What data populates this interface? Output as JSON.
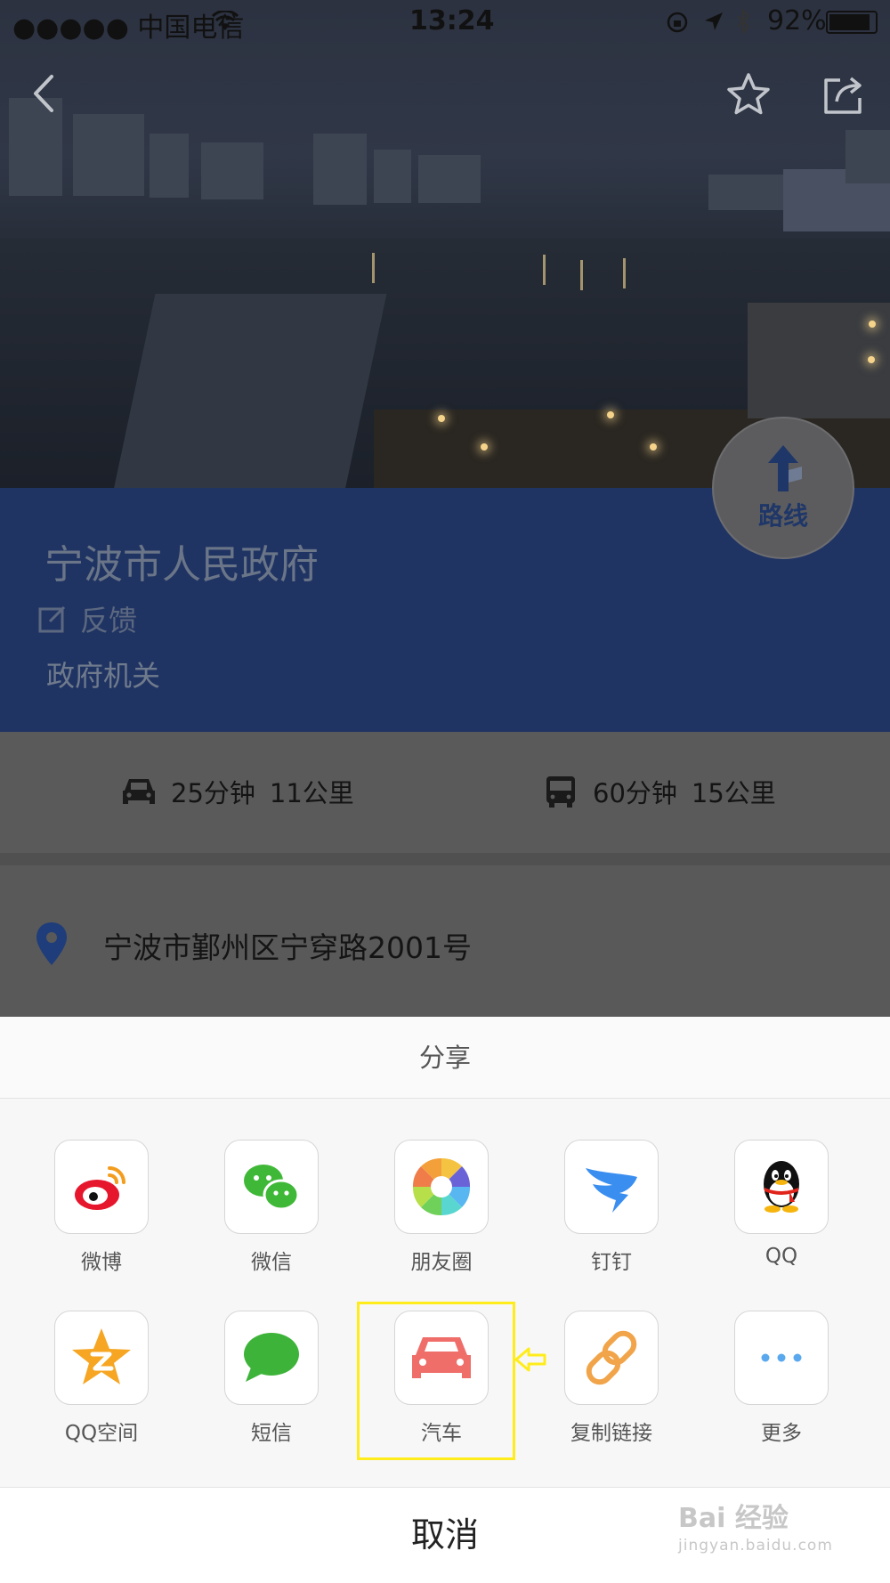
{
  "status_bar": {
    "carrier": "●●●●● 中国电信",
    "time": "13:24",
    "battery": "92%"
  },
  "header": {
    "back_icon": "chevron-left-icon",
    "favorite_icon": "star-icon",
    "share_icon": "share-icon"
  },
  "place": {
    "name": "宁波市人民政府",
    "feedback_label": "反馈",
    "category": "政府机关"
  },
  "route_button": {
    "label": "路线",
    "icon": "route-arrow-icon"
  },
  "travel": {
    "car": {
      "icon": "car-icon",
      "time": "25分钟",
      "distance": "11公里"
    },
    "bus": {
      "icon": "bus-icon",
      "time": "60分钟",
      "distance": "15公里"
    }
  },
  "address": {
    "icon": "location-pin-icon",
    "text": "宁波市鄞州区宁穿路2001号"
  },
  "share_sheet": {
    "title": "分享",
    "items": [
      {
        "label": "微博",
        "icon": "weibo-icon"
      },
      {
        "label": "微信",
        "icon": "wechat-icon"
      },
      {
        "label": "朋友圈",
        "icon": "moments-icon"
      },
      {
        "label": "钉钉",
        "icon": "dingtalk-icon"
      },
      {
        "label": "QQ",
        "icon": "qq-icon"
      },
      {
        "label": "QQ空间",
        "icon": "qzone-icon"
      },
      {
        "label": "短信",
        "icon": "sms-icon"
      },
      {
        "label": "汽车",
        "icon": "car-icon"
      },
      {
        "label": "复制链接",
        "icon": "link-icon"
      },
      {
        "label": "更多",
        "icon": "more-icon"
      }
    ],
    "cancel_label": "取消"
  },
  "watermark": {
    "brand": "Bai 经验",
    "url": "jingyan.baidu.com"
  },
  "colors": {
    "info_panel": "#203463",
    "highlight": "#ffec1a",
    "sheet_background": "#f7f7f7"
  }
}
